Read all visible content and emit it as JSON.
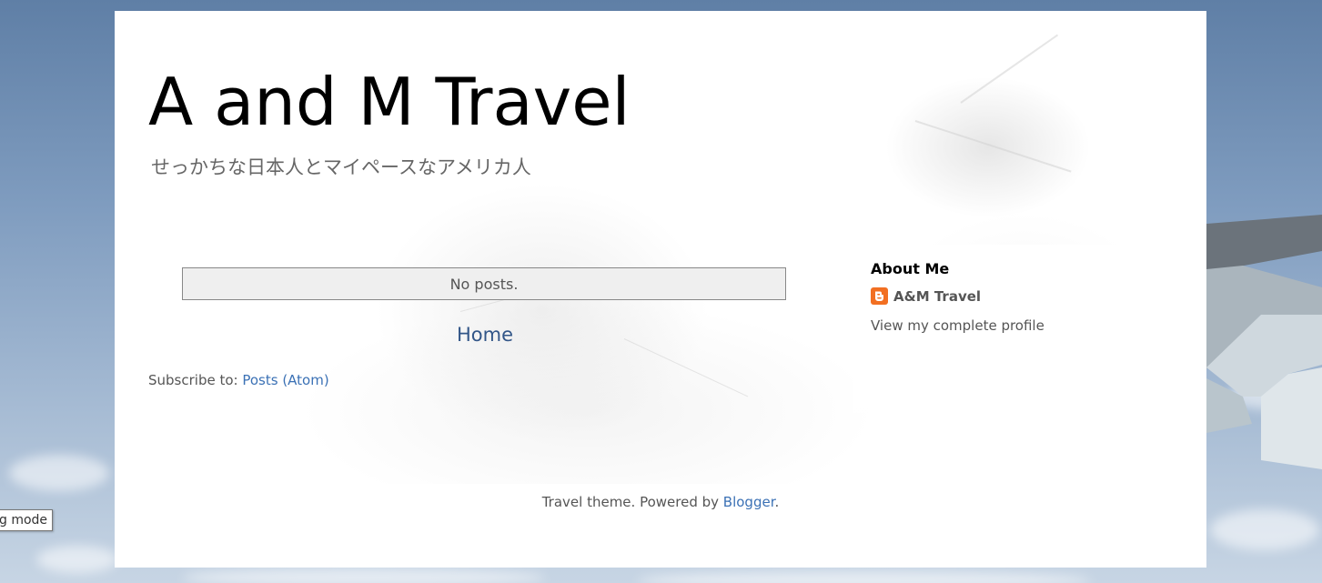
{
  "header": {
    "title": "A and M Travel",
    "description": "せっかちな日本人とマイペースなアメリカ人"
  },
  "main": {
    "status_message": "No posts.",
    "home_link": "Home",
    "subscribe_label": "Subscribe to:",
    "subscribe_link": "Posts (Atom)"
  },
  "sidebar": {
    "title": "About Me",
    "profile_name": "A&M Travel",
    "profile_link": "View my complete profile",
    "profile_icon": "blogger-icon"
  },
  "footer": {
    "theme_text": "Travel theme. Powered by",
    "blogger_link": "Blogger",
    "period": "."
  },
  "badge": {
    "text": "g mode"
  },
  "colors": {
    "link": "#3b71b5",
    "home_link": "#325688",
    "blogger_orange": "#f26f22",
    "text": "#555555"
  }
}
